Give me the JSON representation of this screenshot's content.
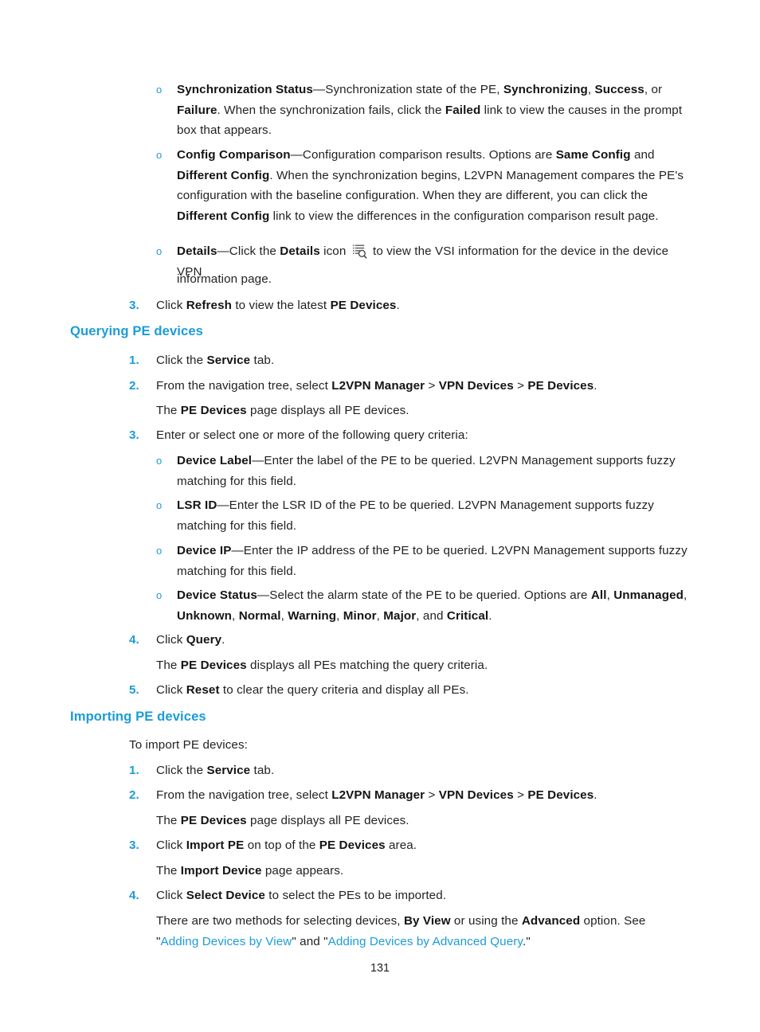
{
  "page": {
    "number": "131",
    "accent_color": "#1b9cd8",
    "text_color": "#231f20"
  },
  "bullets_top": [
    {
      "marker": "o",
      "segments": [
        {
          "t": "Synchronization Status",
          "bold": true
        },
        {
          "t": "—Synchronization state of the PE, "
        },
        {
          "t": "Synchronizing",
          "bold": true
        },
        {
          "t": ", "
        },
        {
          "t": "Success",
          "bold": true
        },
        {
          "t": ", or "
        },
        {
          "t": "Failure",
          "bold": true
        },
        {
          "t": ". When the synchronization fails, click the "
        },
        {
          "t": "Failed",
          "bold": true
        },
        {
          "t": " link to view the causes in the prompt box that appears."
        }
      ]
    },
    {
      "marker": "o",
      "segments": [
        {
          "t": "Config Comparison",
          "bold": true
        },
        {
          "t": "—Configuration comparison results. Options are "
        },
        {
          "t": "Same Config",
          "bold": true
        },
        {
          "t": " and "
        },
        {
          "t": "Different Config",
          "bold": true
        },
        {
          "t": ". When the synchronization begins, L2VPN Management compares the PE's configuration with the baseline configuration. When they are different, you can click the "
        },
        {
          "t": "Different Config",
          "bold": true
        },
        {
          "t": " link to view the differences in the configuration comparison result page."
        }
      ]
    }
  ],
  "details_bullet": {
    "marker": "o",
    "lead_bold": "Details",
    "dash_text": "—Click the ",
    "details_bold": "Details",
    "icon_label": " icon ",
    "icon_name": "details-list-search-icon",
    "tail_text": " to view the VSI information for the device in the device VPN",
    "second_line": "information page."
  },
  "step_refresh": {
    "num": "3.",
    "segments": [
      {
        "t": "Click "
      },
      {
        "t": "Refresh",
        "bold": true
      },
      {
        "t": " to view the latest "
      },
      {
        "t": "PE Devices",
        "bold": true
      },
      {
        "t": "."
      }
    ]
  },
  "querying_section": {
    "heading": "Querying PE devices",
    "step1": {
      "num": "1.",
      "segments": [
        {
          "t": "Click the "
        },
        {
          "t": "Service",
          "bold": true
        },
        {
          "t": " tab."
        }
      ]
    },
    "step2": {
      "num": "2.",
      "segments": [
        {
          "t": "From the navigation tree, select "
        },
        {
          "t": "L2VPN Manager",
          "bold": true
        },
        {
          "t": " > "
        },
        {
          "t": "VPN Devices",
          "bold": true
        },
        {
          "t": " > "
        },
        {
          "t": "PE Devices",
          "bold": true
        },
        {
          "t": "."
        }
      ]
    },
    "step2_note": [
      {
        "t": "The "
      },
      {
        "t": "PE Devices",
        "bold": true
      },
      {
        "t": " page displays all PE devices."
      }
    ],
    "step3": {
      "num": "3.",
      "segments": [
        {
          "t": "Enter or select one or more of the following query criteria:"
        }
      ]
    },
    "criteria": [
      {
        "marker": "o",
        "segments": [
          {
            "t": "Device Label",
            "bold": true
          },
          {
            "t": "—Enter the label of the PE to be queried. L2VPN Management supports fuzzy matching for this field."
          }
        ]
      },
      {
        "marker": "o",
        "segments": [
          {
            "t": "LSR ID",
            "bold": true
          },
          {
            "t": "—Enter the LSR ID of the PE to be queried. L2VPN Management supports fuzzy matching for this field."
          }
        ]
      },
      {
        "marker": "o",
        "segments": [
          {
            "t": "Device IP",
            "bold": true
          },
          {
            "t": "—Enter the IP address of the PE to be queried. L2VPN Management supports fuzzy matching for this field."
          }
        ]
      },
      {
        "marker": "o",
        "segments": [
          {
            "t": "Device Status",
            "bold": true
          },
          {
            "t": "—Select the alarm state of the PE to be queried. Options are "
          },
          {
            "t": "All",
            "bold": true
          },
          {
            "t": ", "
          },
          {
            "t": "Unmanaged",
            "bold": true
          },
          {
            "t": ", "
          },
          {
            "t": "Unknown",
            "bold": true
          },
          {
            "t": ", "
          },
          {
            "t": "Normal",
            "bold": true
          },
          {
            "t": ", "
          },
          {
            "t": "Warning",
            "bold": true
          },
          {
            "t": ", "
          },
          {
            "t": "Minor",
            "bold": true
          },
          {
            "t": ", "
          },
          {
            "t": "Major",
            "bold": true
          },
          {
            "t": ", and "
          },
          {
            "t": "Critical",
            "bold": true
          },
          {
            "t": "."
          }
        ]
      }
    ],
    "step4": {
      "num": "4.",
      "segments": [
        {
          "t": "Click "
        },
        {
          "t": "Query",
          "bold": true
        },
        {
          "t": "."
        }
      ]
    },
    "step4_note": [
      {
        "t": "The "
      },
      {
        "t": "PE Devices",
        "bold": true
      },
      {
        "t": " displays all PEs matching the query criteria."
      }
    ],
    "step5": {
      "num": "5.",
      "segments": [
        {
          "t": "Click "
        },
        {
          "t": "Reset",
          "bold": true
        },
        {
          "t": " to clear the query criteria and display all PEs."
        }
      ]
    }
  },
  "importing_section": {
    "heading": "Importing PE devices",
    "intro": [
      {
        "t": "To import PE devices:"
      }
    ],
    "step1": {
      "num": "1.",
      "segments": [
        {
          "t": "Click the "
        },
        {
          "t": "Service",
          "bold": true
        },
        {
          "t": " tab."
        }
      ]
    },
    "step2": {
      "num": "2.",
      "segments": [
        {
          "t": "From the navigation tree, select "
        },
        {
          "t": "L2VPN Manager",
          "bold": true
        },
        {
          "t": " > "
        },
        {
          "t": "VPN Devices",
          "bold": true
        },
        {
          "t": " > "
        },
        {
          "t": "PE Devices",
          "bold": true
        },
        {
          "t": "."
        }
      ]
    },
    "step2_note": [
      {
        "t": "The "
      },
      {
        "t": "PE Devices",
        "bold": true
      },
      {
        "t": " page displays all PE devices."
      }
    ],
    "step3": {
      "num": "3.",
      "segments": [
        {
          "t": "Click "
        },
        {
          "t": "Import PE",
          "bold": true
        },
        {
          "t": " on top of the "
        },
        {
          "t": "PE Devices",
          "bold": true
        },
        {
          "t": " area."
        }
      ]
    },
    "step3_note": [
      {
        "t": "The "
      },
      {
        "t": "Import Device",
        "bold": true
      },
      {
        "t": " page appears."
      }
    ],
    "step4": {
      "num": "4.",
      "segments": [
        {
          "t": "Click "
        },
        {
          "t": "Select Device",
          "bold": true
        },
        {
          "t": " to select the PEs to be imported."
        }
      ]
    },
    "step4_note": [
      {
        "t": "There are two methods for selecting devices, "
      },
      {
        "t": "By View",
        "bold": true
      },
      {
        "t": " or using the "
      },
      {
        "t": "Advanced",
        "bold": true
      },
      {
        "t": " option. See \""
      },
      {
        "t": "Adding Devices by View",
        "link": true
      },
      {
        "t": "\" and \""
      },
      {
        "t": "Adding Devices by Advanced Query",
        "link": true
      },
      {
        "t": ".\""
      }
    ]
  }
}
